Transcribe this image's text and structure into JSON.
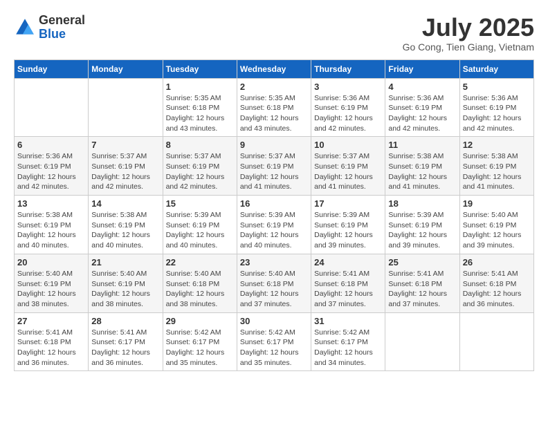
{
  "header": {
    "logo_general": "General",
    "logo_blue": "Blue",
    "month_title": "July 2025",
    "location": "Go Cong, Tien Giang, Vietnam"
  },
  "days_of_week": [
    "Sunday",
    "Monday",
    "Tuesday",
    "Wednesday",
    "Thursday",
    "Friday",
    "Saturday"
  ],
  "weeks": [
    [
      {
        "day": "",
        "info": ""
      },
      {
        "day": "",
        "info": ""
      },
      {
        "day": "1",
        "info": "Sunrise: 5:35 AM\nSunset: 6:18 PM\nDaylight: 12 hours and 43 minutes."
      },
      {
        "day": "2",
        "info": "Sunrise: 5:35 AM\nSunset: 6:18 PM\nDaylight: 12 hours and 43 minutes."
      },
      {
        "day": "3",
        "info": "Sunrise: 5:36 AM\nSunset: 6:19 PM\nDaylight: 12 hours and 42 minutes."
      },
      {
        "day": "4",
        "info": "Sunrise: 5:36 AM\nSunset: 6:19 PM\nDaylight: 12 hours and 42 minutes."
      },
      {
        "day": "5",
        "info": "Sunrise: 5:36 AM\nSunset: 6:19 PM\nDaylight: 12 hours and 42 minutes."
      }
    ],
    [
      {
        "day": "6",
        "info": "Sunrise: 5:36 AM\nSunset: 6:19 PM\nDaylight: 12 hours and 42 minutes."
      },
      {
        "day": "7",
        "info": "Sunrise: 5:37 AM\nSunset: 6:19 PM\nDaylight: 12 hours and 42 minutes."
      },
      {
        "day": "8",
        "info": "Sunrise: 5:37 AM\nSunset: 6:19 PM\nDaylight: 12 hours and 42 minutes."
      },
      {
        "day": "9",
        "info": "Sunrise: 5:37 AM\nSunset: 6:19 PM\nDaylight: 12 hours and 41 minutes."
      },
      {
        "day": "10",
        "info": "Sunrise: 5:37 AM\nSunset: 6:19 PM\nDaylight: 12 hours and 41 minutes."
      },
      {
        "day": "11",
        "info": "Sunrise: 5:38 AM\nSunset: 6:19 PM\nDaylight: 12 hours and 41 minutes."
      },
      {
        "day": "12",
        "info": "Sunrise: 5:38 AM\nSunset: 6:19 PM\nDaylight: 12 hours and 41 minutes."
      }
    ],
    [
      {
        "day": "13",
        "info": "Sunrise: 5:38 AM\nSunset: 6:19 PM\nDaylight: 12 hours and 40 minutes."
      },
      {
        "day": "14",
        "info": "Sunrise: 5:38 AM\nSunset: 6:19 PM\nDaylight: 12 hours and 40 minutes."
      },
      {
        "day": "15",
        "info": "Sunrise: 5:39 AM\nSunset: 6:19 PM\nDaylight: 12 hours and 40 minutes."
      },
      {
        "day": "16",
        "info": "Sunrise: 5:39 AM\nSunset: 6:19 PM\nDaylight: 12 hours and 40 minutes."
      },
      {
        "day": "17",
        "info": "Sunrise: 5:39 AM\nSunset: 6:19 PM\nDaylight: 12 hours and 39 minutes."
      },
      {
        "day": "18",
        "info": "Sunrise: 5:39 AM\nSunset: 6:19 PM\nDaylight: 12 hours and 39 minutes."
      },
      {
        "day": "19",
        "info": "Sunrise: 5:40 AM\nSunset: 6:19 PM\nDaylight: 12 hours and 39 minutes."
      }
    ],
    [
      {
        "day": "20",
        "info": "Sunrise: 5:40 AM\nSunset: 6:19 PM\nDaylight: 12 hours and 38 minutes."
      },
      {
        "day": "21",
        "info": "Sunrise: 5:40 AM\nSunset: 6:19 PM\nDaylight: 12 hours and 38 minutes."
      },
      {
        "day": "22",
        "info": "Sunrise: 5:40 AM\nSunset: 6:18 PM\nDaylight: 12 hours and 38 minutes."
      },
      {
        "day": "23",
        "info": "Sunrise: 5:40 AM\nSunset: 6:18 PM\nDaylight: 12 hours and 37 minutes."
      },
      {
        "day": "24",
        "info": "Sunrise: 5:41 AM\nSunset: 6:18 PM\nDaylight: 12 hours and 37 minutes."
      },
      {
        "day": "25",
        "info": "Sunrise: 5:41 AM\nSunset: 6:18 PM\nDaylight: 12 hours and 37 minutes."
      },
      {
        "day": "26",
        "info": "Sunrise: 5:41 AM\nSunset: 6:18 PM\nDaylight: 12 hours and 36 minutes."
      }
    ],
    [
      {
        "day": "27",
        "info": "Sunrise: 5:41 AM\nSunset: 6:18 PM\nDaylight: 12 hours and 36 minutes."
      },
      {
        "day": "28",
        "info": "Sunrise: 5:41 AM\nSunset: 6:17 PM\nDaylight: 12 hours and 36 minutes."
      },
      {
        "day": "29",
        "info": "Sunrise: 5:42 AM\nSunset: 6:17 PM\nDaylight: 12 hours and 35 minutes."
      },
      {
        "day": "30",
        "info": "Sunrise: 5:42 AM\nSunset: 6:17 PM\nDaylight: 12 hours and 35 minutes."
      },
      {
        "day": "31",
        "info": "Sunrise: 5:42 AM\nSunset: 6:17 PM\nDaylight: 12 hours and 34 minutes."
      },
      {
        "day": "",
        "info": ""
      },
      {
        "day": "",
        "info": ""
      }
    ]
  ]
}
